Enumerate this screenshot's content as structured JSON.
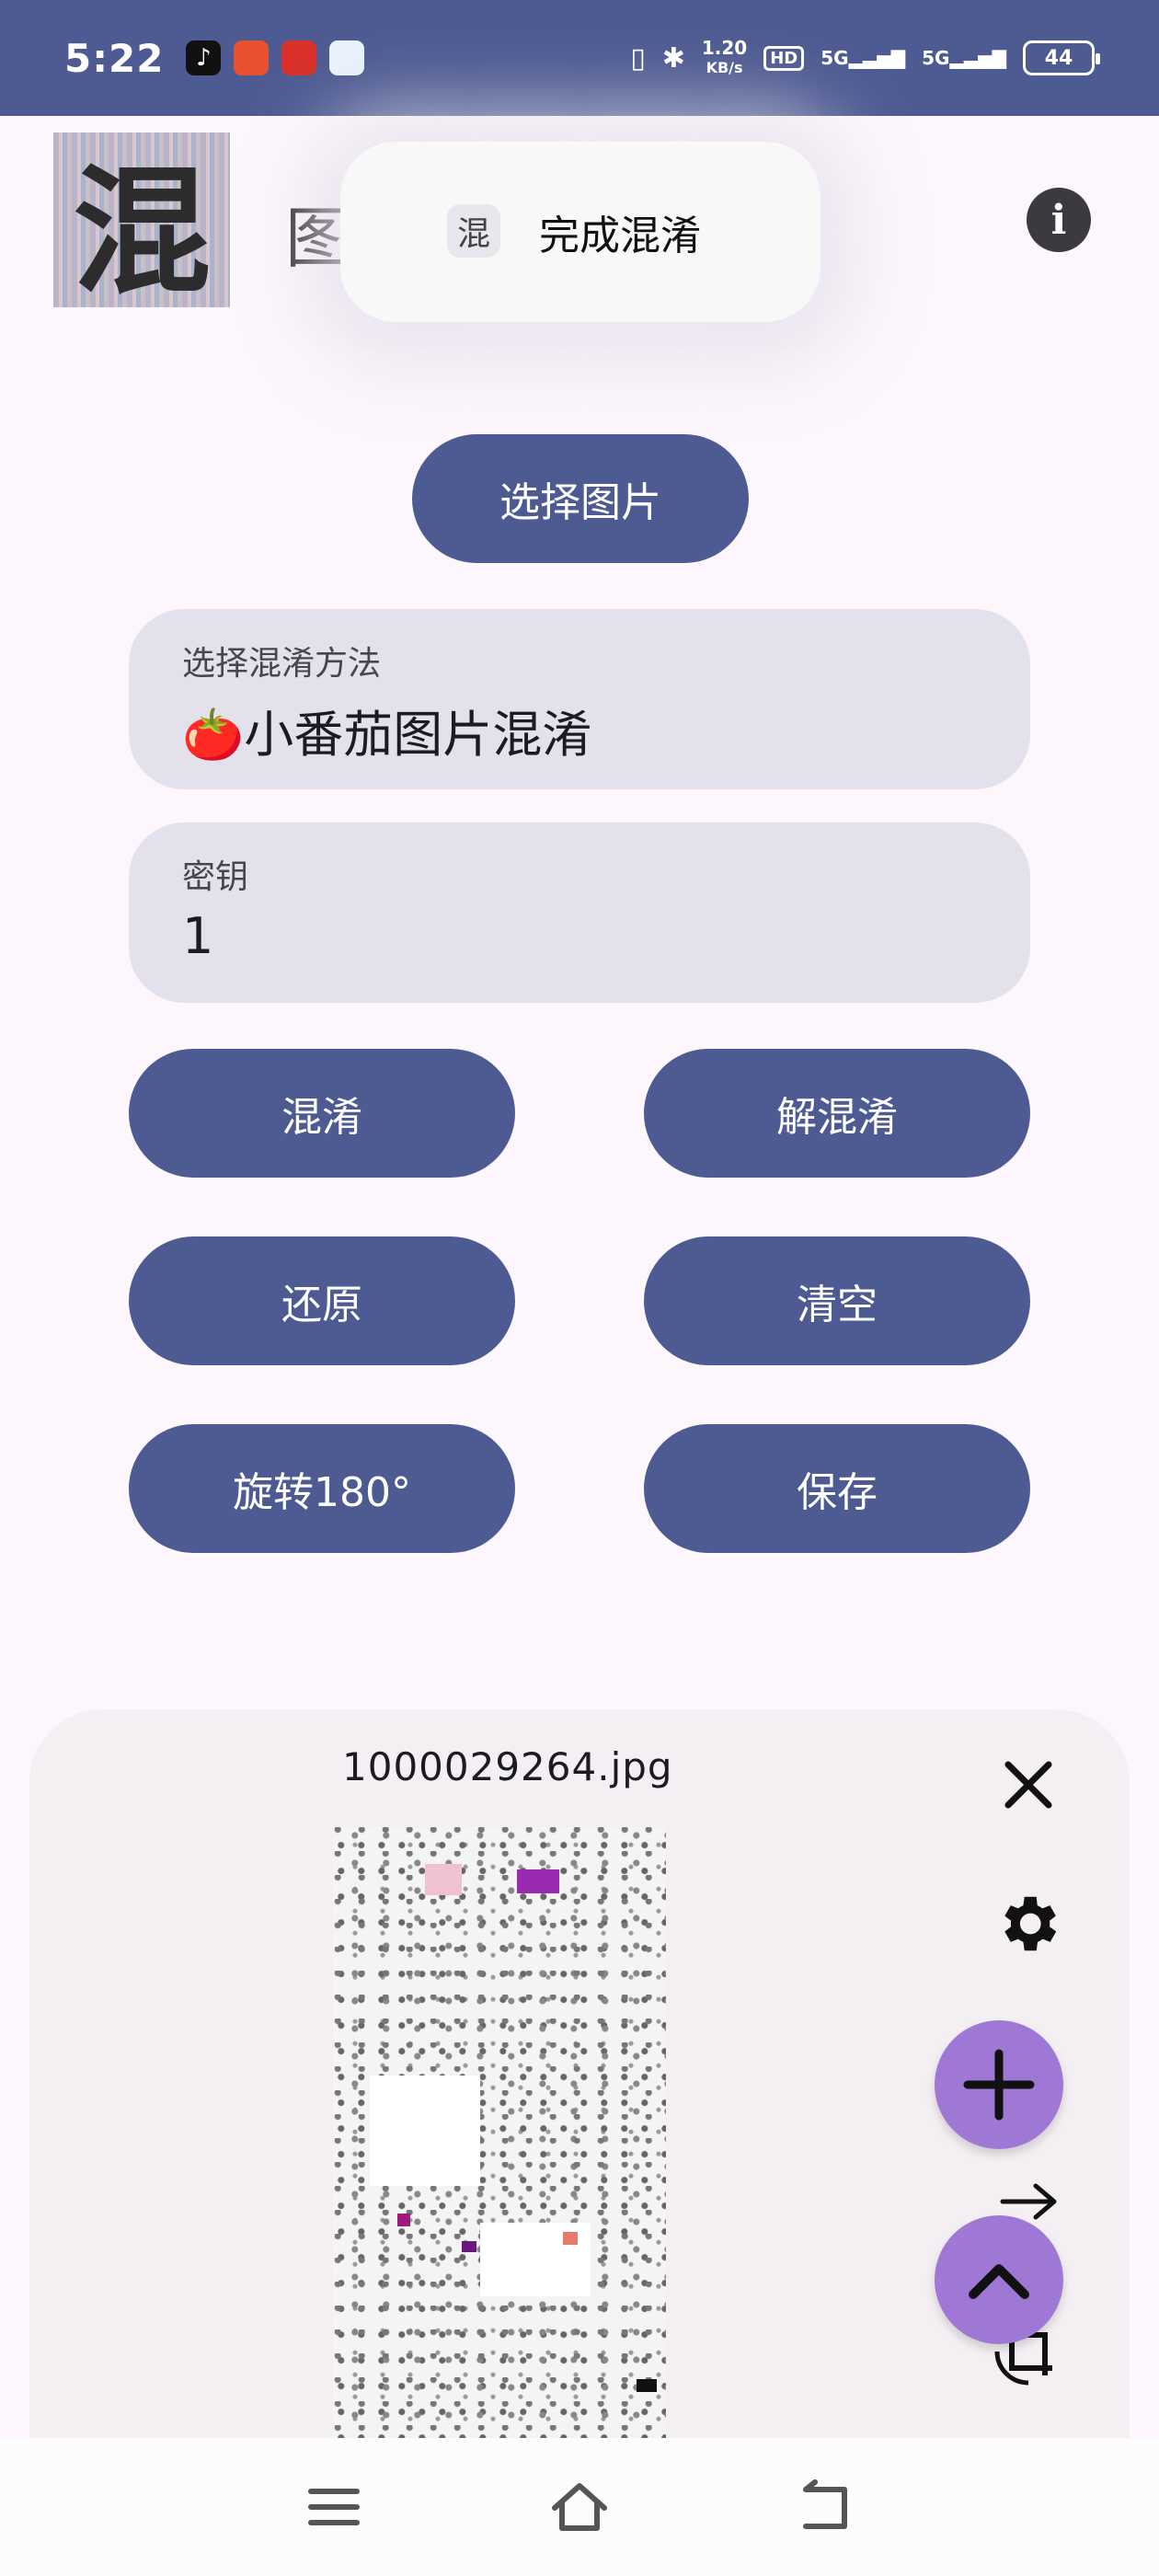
{
  "status_bar": {
    "time": "5:22",
    "net_speed_value": "1.20",
    "net_speed_unit": "KB/s",
    "hd_label": "HD",
    "signal_1": "5G",
    "signal_2": "5G",
    "battery": "44",
    "app_icons": [
      "tiktok-icon",
      "app-icon-red",
      "app-icon-red-2",
      "app-icon-blue"
    ],
    "bg_color": "#4e5b92"
  },
  "header": {
    "logo_char": "混",
    "title": "图",
    "info_icon": "info-icon"
  },
  "toast": {
    "icon_char": "混",
    "text": "完成混淆"
  },
  "actions": {
    "select_image": "选择图片",
    "obfuscate": "混淆",
    "deobfuscate": "解混淆",
    "restore": "还原",
    "clear": "清空",
    "rotate": "旋转180°",
    "save": "保存"
  },
  "method_field": {
    "label": "选择混淆方法",
    "value": "🍅小番茄图片混淆"
  },
  "key_field": {
    "label": "密钥",
    "value": "1"
  },
  "preview_sheet": {
    "file_name": "1000029264.jpg",
    "close_icon": "close-icon",
    "settings_icon": "gear-icon",
    "add_icon": "plus-icon",
    "arrow_icon": "arrow-right-icon",
    "collapse_icon": "chevron-up-icon",
    "crop_rotate_icon": "crop-rotate-icon"
  },
  "nav_bar": {
    "icons": [
      "menu-icon",
      "home-icon",
      "back-icon"
    ]
  },
  "colors": {
    "primary": "#4e5b92",
    "fab": "#9e78d4",
    "field_bg": "#e3e1eb",
    "background": "#fdf7fd"
  }
}
